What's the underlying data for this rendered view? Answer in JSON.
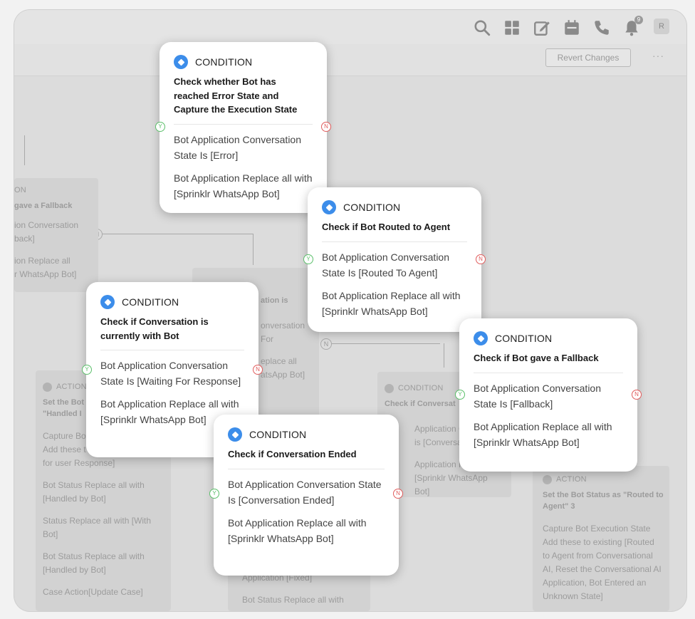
{
  "toolbar": {
    "icons": [
      "search-icon",
      "apps-grid-icon",
      "edit-icon",
      "calendar-icon",
      "phone-icon",
      "bell-icon"
    ],
    "notification_count": "9",
    "avatar_initial": "R"
  },
  "header": {
    "revert_label": "Revert Changes",
    "more_label": "···"
  },
  "branch_labels": {
    "yes": "Y",
    "no": "N"
  },
  "background": {
    "connector_label": "N",
    "fallback_node": {
      "type": "ON",
      "title": "gave a Fallback",
      "lines": [
        "ion Conversation",
        "back]",
        "ion Replace all",
        "r WhatsApp Bot]"
      ]
    },
    "mid_node": {
      "title": "ation is",
      "lines": [
        "onversation",
        "For",
        "eplace all",
        "atsApp Bot]"
      ]
    },
    "left_action": {
      "type": "ACTION",
      "title": "Set the Bot",
      "title2": "\"Handled I",
      "lines": [
        "Capture Bo",
        "Add these t",
        "for user Response]",
        "Bot Status Replace all with [Handled by Bot]",
        "Status Replace all with [With Bot]",
        "Bot Status Replace all with [Handled by Bot]",
        "Case Action[Update Case]"
      ]
    },
    "mid_bottom": {
      "lines": [
        "Application [Fixed]",
        "Bot Status Replace all with"
      ]
    },
    "center_node": {
      "type": "CONDITION",
      "title": "Check if Conversat",
      "lines": [
        "Application Co",
        "is [Conversati",
        "Application Rep",
        "[Sprinklr WhatsApp Bot]"
      ]
    },
    "right_action": {
      "type": "ACTION",
      "title": "Set the Bot Status as \"Routed to Agent\" 3",
      "lines": [
        "Capture Bot Execution State",
        "Add these to existing [Routed to Agent from Conversational AI, Reset the Conversational AI Application, Bot Entered an Unknown State]"
      ]
    }
  },
  "cards": [
    {
      "type": "CONDITION",
      "title": "Check whether Bot has reached Error State and Capture the Execution State",
      "lines": [
        "Bot Application Conversation State Is [Error]",
        "Bot Application Replace all with [Sprinklr WhatsApp Bot]"
      ]
    },
    {
      "type": "CONDITION",
      "title": "Check if Bot Routed to Agent",
      "lines": [
        "Bot Application Conversation State Is [Routed To Agent]",
        "Bot Application Replace all with [Sprinklr WhatsApp Bot]"
      ]
    },
    {
      "type": "CONDITION",
      "title": "Check if Conversation is currently with Bot",
      "lines": [
        "Bot Application Conversation State Is [Waiting For Response]",
        "Bot Application Replace all with [Sprinklr WhatsApp Bot]"
      ]
    },
    {
      "type": "CONDITION",
      "title": "Check if Bot gave a Fallback",
      "lines": [
        "Bot Application Conversation State Is [Fallback]",
        "Bot Application Replace all with [Sprinklr WhatsApp Bot]"
      ]
    },
    {
      "type": "CONDITION",
      "title": "Check if Conversation Ended",
      "lines": [
        "Bot Application Conversation State Is [Conversation Ended]",
        "Bot Application Replace all with [Sprinklr WhatsApp Bot]"
      ]
    }
  ],
  "colors": {
    "condition_icon": "#3c8dea",
    "yes_branch": "#5bbf6a",
    "no_branch": "#e05b5b",
    "canvas": "#dcdcdc"
  }
}
